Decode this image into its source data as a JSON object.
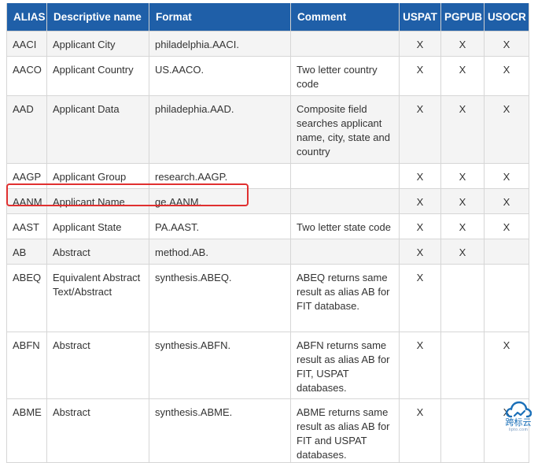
{
  "table": {
    "headers": [
      "ALIAS",
      "Descriptive name",
      "Format",
      "Comment",
      "USPAT",
      "PGPUB",
      "USOCR"
    ],
    "rows": [
      {
        "alias": "AACI",
        "desc": "Applicant City",
        "format": "philadelphia.AACI.",
        "comment": "",
        "uspat": "X",
        "pgpub": "X",
        "usocr": "X"
      },
      {
        "alias": "AACO",
        "desc": "Applicant Country",
        "format": "US.AACO.",
        "comment": "Two letter country code",
        "uspat": "X",
        "pgpub": "X",
        "usocr": "X"
      },
      {
        "alias": "AAD",
        "desc": "Applicant Data",
        "format": "philadephia.AAD.",
        "comment": "Composite field searches applicant name, city, state and country",
        "uspat": "X",
        "pgpub": "X",
        "usocr": "X"
      },
      {
        "alias": "AAGP",
        "desc": "Applicant Group",
        "format": "research.AAGP.",
        "comment": "",
        "uspat": "X",
        "pgpub": "X",
        "usocr": "X"
      },
      {
        "alias": "AANM",
        "desc": "Applicant Name",
        "format": "ge.AANM.",
        "comment": "",
        "uspat": "X",
        "pgpub": "X",
        "usocr": "X"
      },
      {
        "alias": "AAST",
        "desc": "Applicant State",
        "format": "PA.AAST.",
        "comment": "Two letter state code",
        "uspat": "X",
        "pgpub": "X",
        "usocr": "X"
      },
      {
        "alias": "AB",
        "desc": "Abstract",
        "format": "method.AB.",
        "comment": "",
        "uspat": "X",
        "pgpub": "X",
        "usocr": ""
      },
      {
        "alias": "ABEQ",
        "desc": "Equivalent Abstract Text/Abstract",
        "format": "synthesis.ABEQ.",
        "comment": "ABEQ returns same result as alias AB for FIT database.",
        "uspat": "X",
        "pgpub": "",
        "usocr": ""
      },
      {
        "alias": "ABFN",
        "desc": "Abstract",
        "format": "synthesis.ABFN.",
        "comment": "ABFN returns same result as alias AB for FIT, USPAT databases.",
        "uspat": "X",
        "pgpub": "",
        "usocr": "X"
      },
      {
        "alias": "ABME",
        "desc": "Abstract",
        "format": "synthesis.ABME.",
        "comment": "ABME returns same result as alias AB for FIT and USPAT databases.",
        "uspat": "X",
        "pgpub": "",
        "usocr": "X"
      }
    ]
  },
  "highlighted_row_alias": "AANM",
  "watermark": {
    "brand": "跨标云",
    "sub": "lipto.com",
    "icon": "cloud-icon"
  },
  "colors": {
    "header_bg": "#1f5fa8",
    "highlight_border": "#e03030",
    "zebra": "#f4f4f4"
  }
}
